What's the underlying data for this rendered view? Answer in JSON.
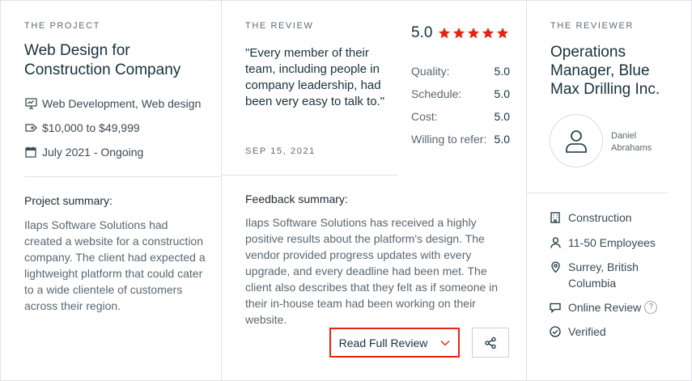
{
  "project": {
    "label": "THE PROJECT",
    "title": "Web Design for Construction Company",
    "services": "Web Development, Web design",
    "budget": "$10,000 to $49,999",
    "dates": "July 2021 - Ongoing",
    "summary_heading": "Project summary:",
    "summary": "Ilaps Software Solutions had created a website for a construction company. The client had expected a lightweight platform that could cater to a wide clientele of customers across their region."
  },
  "review": {
    "label": "THE REVIEW",
    "quote": "\"Every member of their team, including people in company leadership, had been very easy to talk to.\"",
    "date": "SEP 15, 2021",
    "overall": "5.0",
    "stars": 5,
    "scores": [
      {
        "label": "Quality:",
        "value": "5.0"
      },
      {
        "label": "Schedule:",
        "value": "5.0"
      },
      {
        "label": "Cost:",
        "value": "5.0"
      },
      {
        "label": "Willing to refer:",
        "value": "5.0"
      }
    ],
    "feedback_heading": "Feedback summary:",
    "feedback": "Ilaps Software Solutions has received a highly positive results about the platform's design. The vendor provided progress updates with every upgrade, and every deadline had been met. The client also describes that they felt as if someone in their in-house team had been working on their website.",
    "read_full_label": "Read Full Review"
  },
  "reviewer": {
    "label": "THE REVIEWER",
    "title": "Operations Manager, Blue Max Drilling Inc.",
    "name_first": "Daniel",
    "name_last": "Abrahams",
    "industry": "Construction",
    "employees": "11-50 Employees",
    "location": "Surrey, British Columbia",
    "review_type": "Online Review",
    "help_mark": "?",
    "verified": "Verified"
  },
  "colors": {
    "accent": "#e62415",
    "border": "#dde3e8",
    "heading": "#17313b",
    "muted": "#5a6770"
  }
}
